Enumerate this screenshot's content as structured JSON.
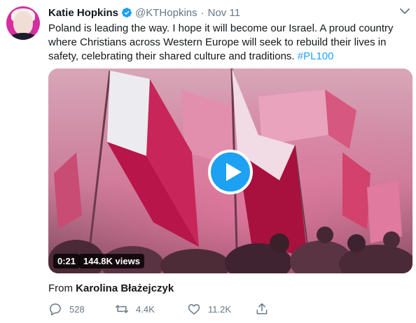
{
  "tweet": {
    "author_name": "Katie Hopkins",
    "handle": "@KTHopkins",
    "separator": "·",
    "date": "Nov 11",
    "text": "Poland is leading the way. I hope it will become our Israel. A proud country where Christians across Western Europe will seek to rebuild their lives in safety, celebrating their shared culture and traditions. ",
    "hashtag": "#PL100"
  },
  "video": {
    "duration": "0:21",
    "views": "144.8K views"
  },
  "attribution": {
    "prefix": "From",
    "source": "Karolina Błażejczyk"
  },
  "actions": {
    "replies": "528",
    "retweets": "4.4K",
    "likes": "11.2K"
  },
  "colors": {
    "accent": "#1da1f2",
    "secondary_text": "#657786",
    "flag_red": "#c3255b",
    "smoke_pink": "#e59ab4"
  },
  "icons": [
    "verified-badge-icon",
    "chevron-down-icon",
    "play-icon",
    "reply-icon",
    "retweet-icon",
    "like-icon",
    "share-icon"
  ]
}
